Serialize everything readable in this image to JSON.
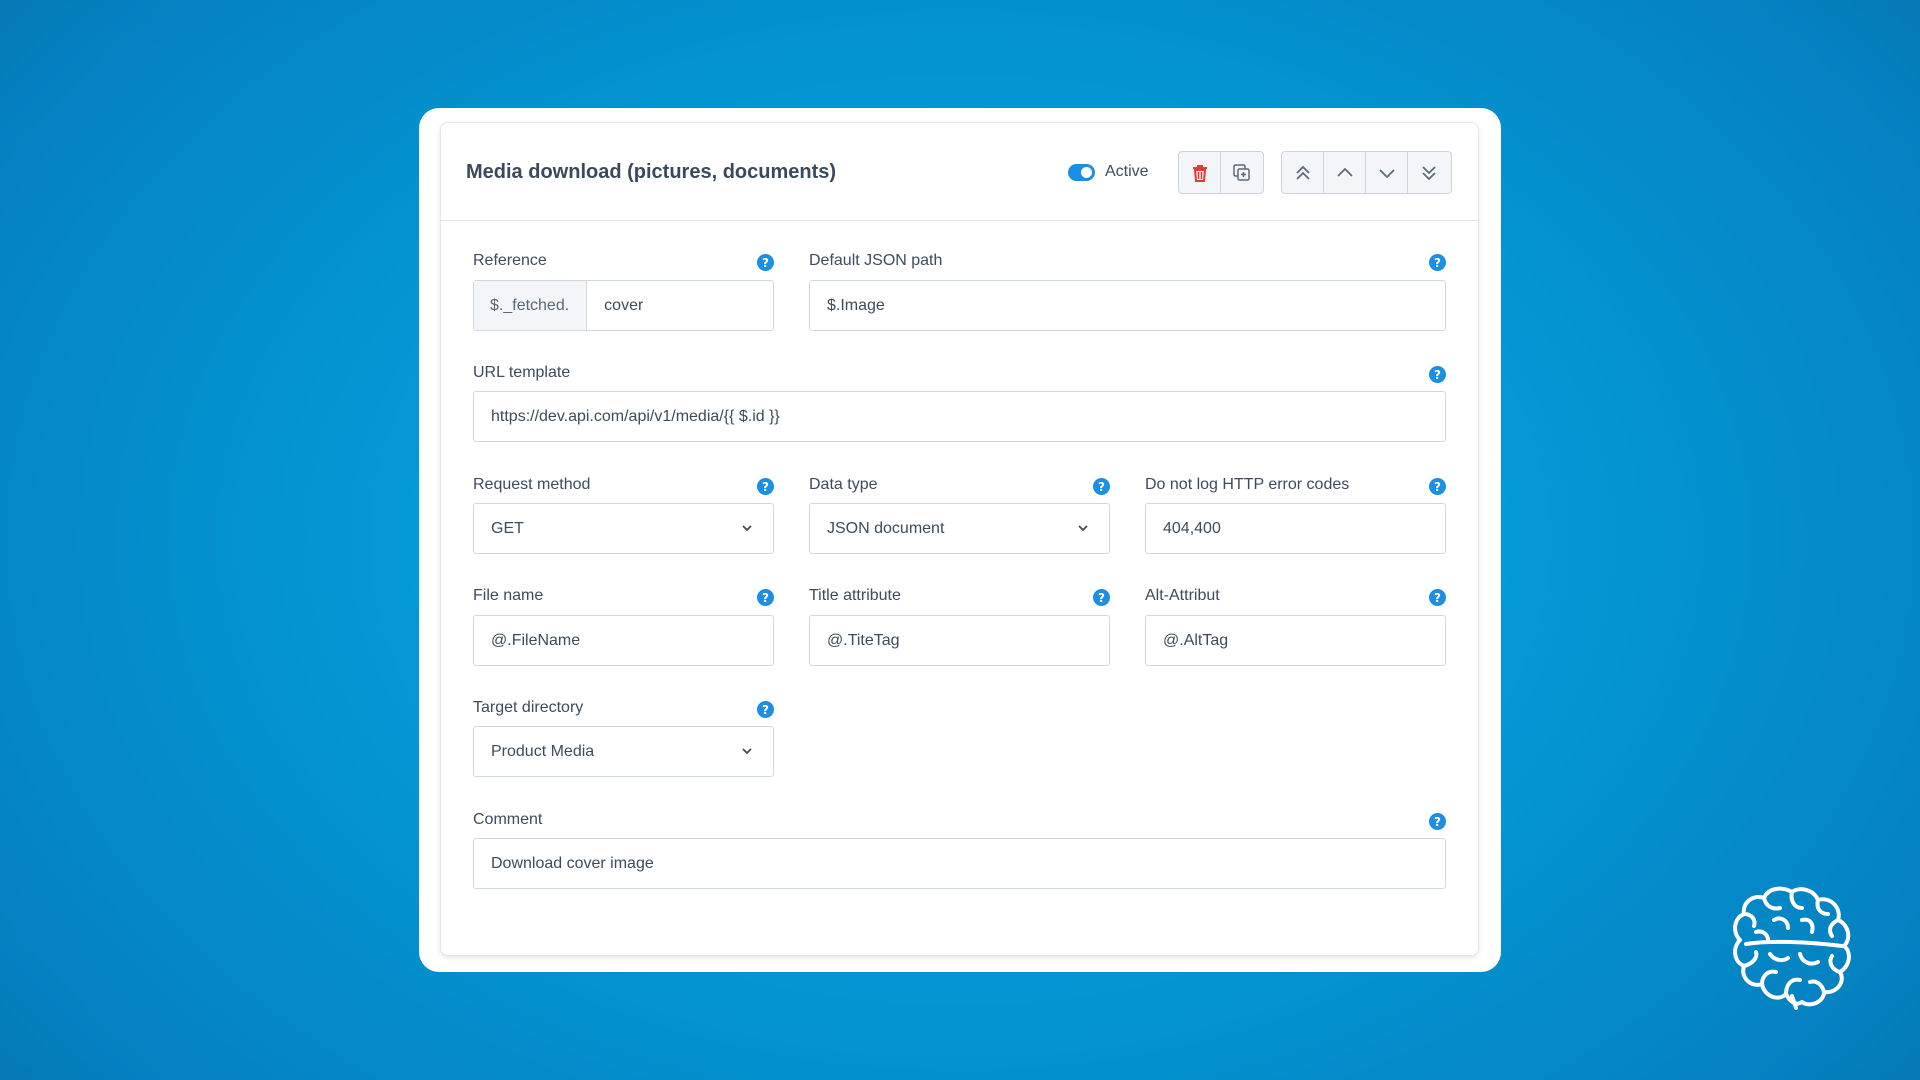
{
  "card": {
    "title": "Media download (pictures, documents)",
    "active_label": "Active",
    "active": true
  },
  "toolbar": {
    "delete_icon": "trash-icon",
    "duplicate_icon": "duplicate-icon",
    "move_top_icon": "double-chevron-up-icon",
    "move_up_icon": "chevron-up-icon",
    "move_down_icon": "chevron-down-icon",
    "move_bottom_icon": "double-chevron-down-icon"
  },
  "fields": {
    "reference": {
      "label": "Reference",
      "prefix": "$._fetched.",
      "value": "cover"
    },
    "default_json_path": {
      "label": "Default JSON path",
      "value": "$.Image"
    },
    "url_template": {
      "label": "URL template",
      "value": "https://dev.api.com/api/v1/media/{{ $.id }}"
    },
    "request_method": {
      "label": "Request method",
      "value": "GET"
    },
    "data_type": {
      "label": "Data type",
      "value": "JSON document"
    },
    "no_log_codes": {
      "label": "Do not log HTTP error codes",
      "value": "404,400"
    },
    "file_name": {
      "label": "File name",
      "value": "@.FileName"
    },
    "title_attribute": {
      "label": "Title attribute",
      "value": "@.TiteTag"
    },
    "alt_attribute": {
      "label": "Alt-Attribut",
      "value": "@.AltTag"
    },
    "target_directory": {
      "label": "Target directory",
      "value": "Product Media"
    },
    "comment": {
      "label": "Comment",
      "value": "Download cover image"
    }
  },
  "help_icon": "?",
  "colors": {
    "accent": "#1a8fe3",
    "delete": "#e53935",
    "background": "#0498d6"
  },
  "logo_icon": "brain-icon"
}
